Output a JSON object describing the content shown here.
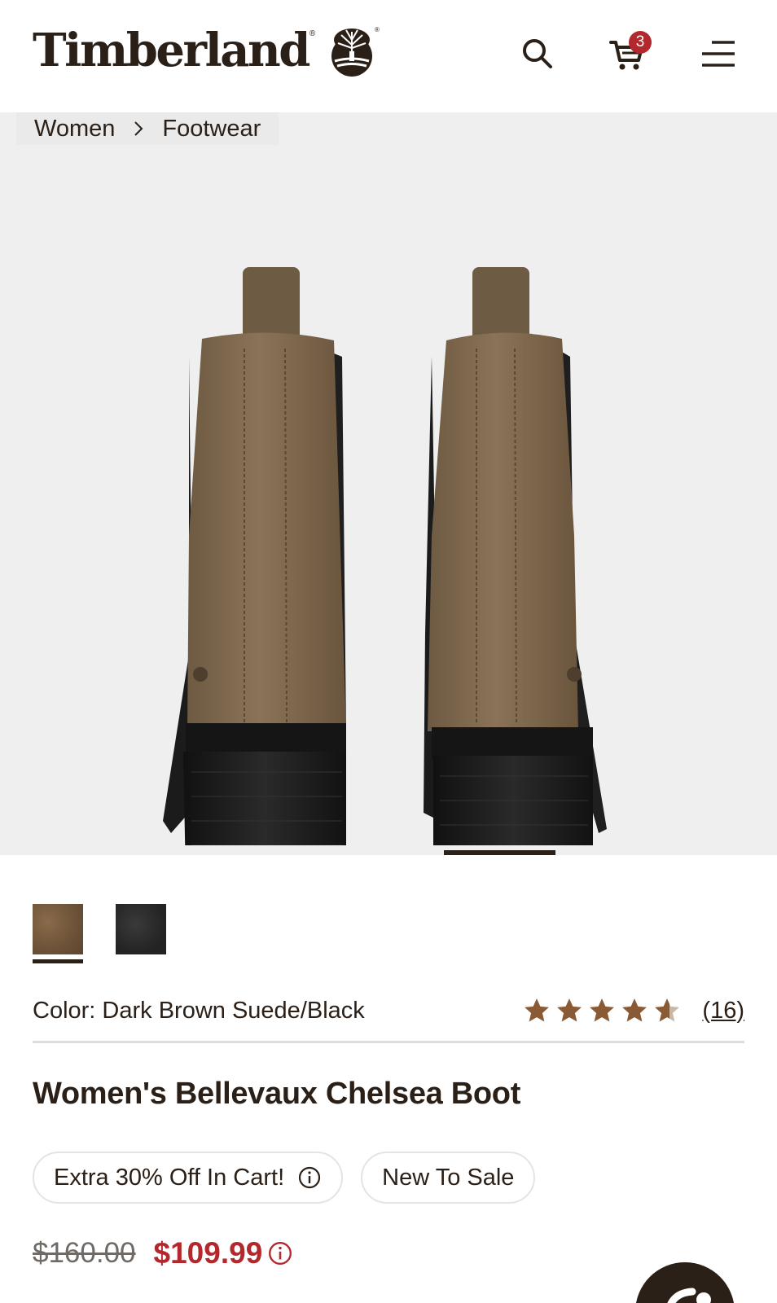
{
  "header": {
    "brand": "Timberland",
    "cart_count": "3"
  },
  "breadcrumb": {
    "items": [
      "Women",
      "Footwear"
    ]
  },
  "gallery": {
    "current_slide_indicator": "active"
  },
  "product": {
    "color_label": "Color: Dark Brown Suede/Black",
    "rating": 4.5,
    "review_count": "(16)",
    "title": "Women's Bellevaux Chelsea Boot",
    "promo_badge": "Extra 30% Off In Cart!",
    "status_badge": "New To Sale",
    "original_price": "$160.00",
    "sale_price": "$109.99"
  },
  "swatches": [
    {
      "name": "dark-brown-suede",
      "color": "#6b5238",
      "selected": true
    },
    {
      "name": "black",
      "color": "#262626",
      "selected": false
    }
  ],
  "colors": {
    "brand_dark": "#2b2018",
    "sale_red": "#b3282d",
    "star": "#8a5a34",
    "gallery_bg": "#efefef"
  },
  "icons": [
    "tree-logo-icon",
    "search-icon",
    "cart-icon",
    "menu-icon",
    "chevron-right-icon",
    "star-icon",
    "info-icon",
    "chat-icon"
  ]
}
